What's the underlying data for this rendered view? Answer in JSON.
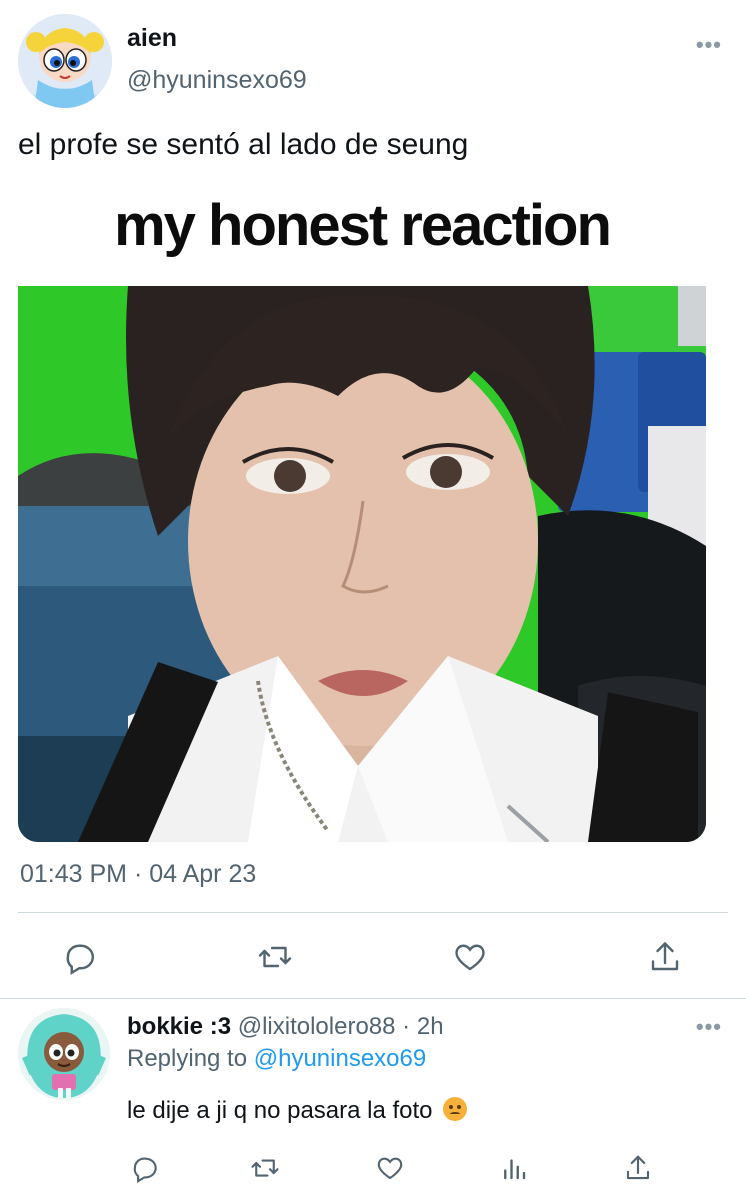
{
  "tweet": {
    "author_name": "aien",
    "author_handle": "@hyuninsexo69",
    "text": "el profe se sentó al lado de seung",
    "media_caption": "my honest reaction",
    "timestamp": "01:43 PM · 04 Apr 23",
    "more_label": "•••",
    "actions": [
      "reply-icon",
      "retweet-icon",
      "like-icon",
      "share-icon"
    ]
  },
  "reply": {
    "author_name": "bokkie :3",
    "author_handle": "@lixitololero88",
    "time": "2h",
    "replying_prefix": "Replying to",
    "replying_handle": "@hyuninsexo69",
    "text": "le dije a ji q no pasara la foto",
    "more_label": "•••",
    "actions": [
      "reply-icon",
      "retweet-icon",
      "like-icon",
      "analytics-icon",
      "share-icon"
    ]
  },
  "colors": {
    "text_primary": "#0f1419",
    "text_secondary": "#536471",
    "link": "#1d9bf0",
    "divider": "#cfd9de",
    "icon": "#536471"
  }
}
